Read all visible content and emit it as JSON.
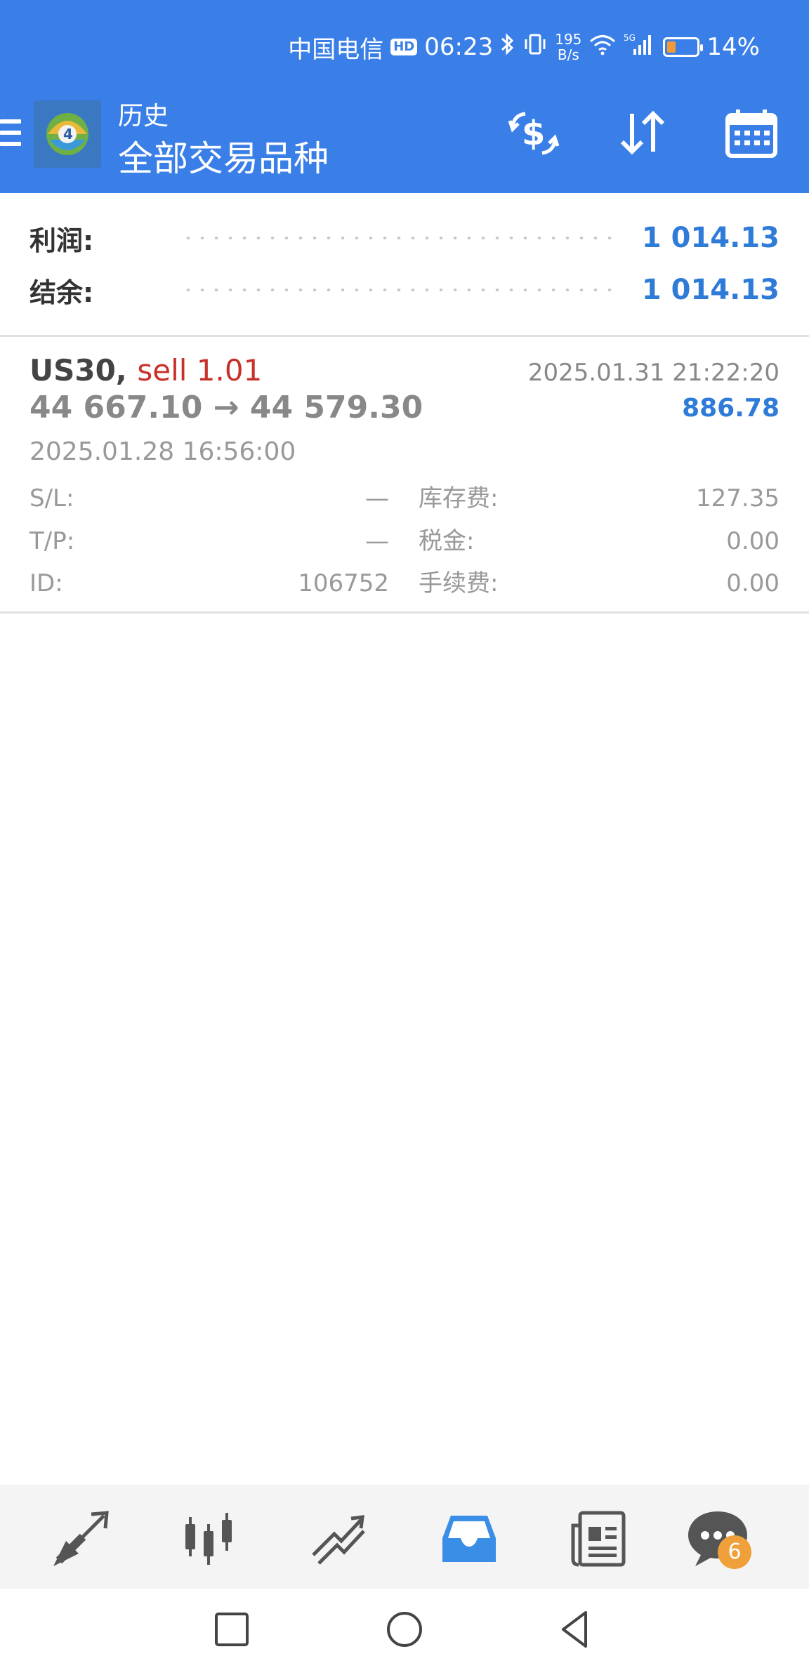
{
  "status_bar": {
    "carrier": "中国电信",
    "hd": "HD",
    "time": "06:23",
    "speed_value": "195",
    "speed_unit": "B/s",
    "network": "5G",
    "battery": "14%",
    "battery_level": 0.14
  },
  "header": {
    "subtitle": "历史",
    "title": "全部交易品种"
  },
  "summary": {
    "profit_label": "利润:",
    "profit_value": "1 014.13",
    "balance_label": "结余:",
    "balance_value": "1 014.13"
  },
  "trades": [
    {
      "symbol": "US30,",
      "side": "sell 1.01",
      "open_price": "44 667.10",
      "arrow": "→",
      "close_price": "44 579.30",
      "close_time": "2025.01.31 21:22:20",
      "profit": "886.78",
      "open_time": "2025.01.28 16:56:00",
      "sl_label": "S/L:",
      "sl_value": "—",
      "tp_label": "T/P:",
      "tp_value": "—",
      "id_label": "ID:",
      "id_value": "106752",
      "swap_label": "库存费:",
      "swap_value": "127.35",
      "tax_label": "税金:",
      "tax_value": "0.00",
      "commission_label": "手续费:",
      "commission_value": "0.00"
    }
  ],
  "bottom_nav": {
    "chat_badge": "6"
  },
  "colors": {
    "header_bg": "#3a7fe8",
    "accent_blue": "#2f7bd8",
    "sell_red": "#c8312a",
    "badge_orange": "#f0a03a"
  },
  "icons": {
    "toolbar": [
      "dollar-exchange-icon",
      "sort-icon",
      "calendar-icon"
    ],
    "nav": [
      "trade-arrows-icon",
      "candlestick-icon",
      "chart-line-icon",
      "history-inbox-icon",
      "news-icon",
      "chat-icon"
    ]
  }
}
